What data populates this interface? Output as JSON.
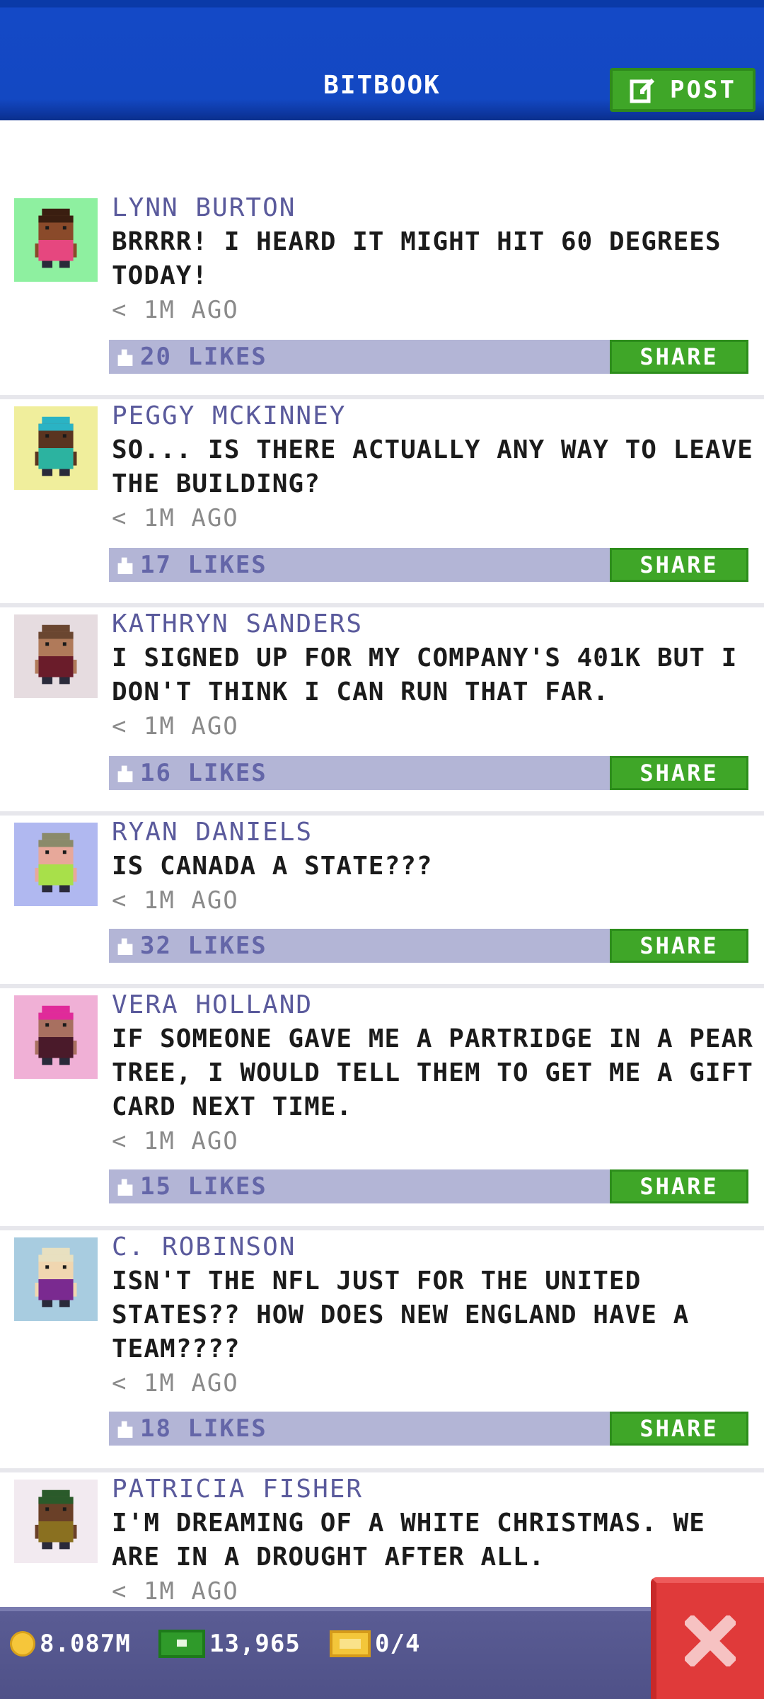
{
  "header": {
    "title": "BITBOOK",
    "post_label": "POST"
  },
  "posts": [
    {
      "author": "LYNN BURTON",
      "text": "BRRRR! I HEARD IT MIGHT HIT 60 DEGREES TODAY!",
      "time": "< 1M AGO",
      "likes": "20 LIKES",
      "share_label": "SHARE",
      "avatar_bg": "#8ef0a0",
      "skin": "#8a4a2a",
      "hair": "#3a1e10",
      "shirt": "#e6477f"
    },
    {
      "author": "PEGGY MCKINNEY",
      "text": "SO... IS THERE ACTUALLY ANY WAY TO LEAVE THE BUILDING?",
      "time": "< 1M AGO",
      "likes": "17 LIKES",
      "share_label": "SHARE",
      "avatar_bg": "#f0ee9c",
      "skin": "#5a3420",
      "hair": "#2ab3c4",
      "shirt": "#2cb3a0"
    },
    {
      "author": "KATHRYN SANDERS",
      "text": "I SIGNED UP FOR MY COMPANY'S 401K BUT I DON'T THINK I CAN RUN THAT FAR.",
      "time": "< 1M AGO",
      "likes": "16 LIKES",
      "share_label": "SHARE",
      "avatar_bg": "#e6dce0",
      "skin": "#b07a5a",
      "hair": "#6a4630",
      "shirt": "#6a1c2a"
    },
    {
      "author": "RYAN DANIELS",
      "text": "IS CANADA A STATE???",
      "time": "< 1M AGO",
      "likes": "32 LIKES",
      "share_label": "SHARE",
      "avatar_bg": "#b0b8f0",
      "skin": "#e7a89a",
      "hair": "#8a8a6a",
      "shirt": "#a8e04a"
    },
    {
      "author": "VERA HOLLAND",
      "text": "IF SOMEONE GAVE ME A PARTRIDGE IN A PEAR TREE, I WOULD TELL THEM TO GET ME A GIFT CARD NEXT TIME.",
      "time": "< 1M AGO",
      "likes": "15 LIKES",
      "share_label": "SHARE",
      "avatar_bg": "#f0b0d6",
      "skin": "#a87060",
      "hair": "#e02a9a",
      "shirt": "#4a1a2a"
    },
    {
      "author": "C. ROBINSON",
      "text": "ISN'T THE NFL JUST FOR THE UNITED STATES?? HOW DOES NEW ENGLAND HAVE A TEAM????",
      "time": "< 1M AGO",
      "likes": "18 LIKES",
      "share_label": "SHARE",
      "avatar_bg": "#a8cce0",
      "skin": "#f0d6b0",
      "hair": "#e8e0c0",
      "shirt": "#7a2a90"
    },
    {
      "author": "PATRICIA FISHER",
      "text": "I'M DREAMING OF A WHITE CHRISTMAS. WE ARE IN A DROUGHT AFTER ALL.",
      "time": "< 1M AGO",
      "likes": "",
      "share_label": "SHARE",
      "avatar_bg": "#f2eaf0",
      "skin": "#6a4028",
      "hair": "#2a5a2a",
      "shirt": "#8a7020"
    }
  ],
  "status": {
    "coins": "8.087M",
    "bux": "13,965",
    "tickets": "0/4"
  },
  "colors": {
    "header_blue": "#1348c2",
    "accent_green": "#3fa628",
    "like_bar": "#b3b5d6",
    "author_purple": "#5a5a9c",
    "close_red": "#e03a3a"
  },
  "icons": {
    "post": "edit-icon",
    "like": "thumbs-up-icon",
    "coin": "coin-icon",
    "bux": "bux-icon",
    "ticket": "ticket-icon",
    "close": "close-icon"
  }
}
